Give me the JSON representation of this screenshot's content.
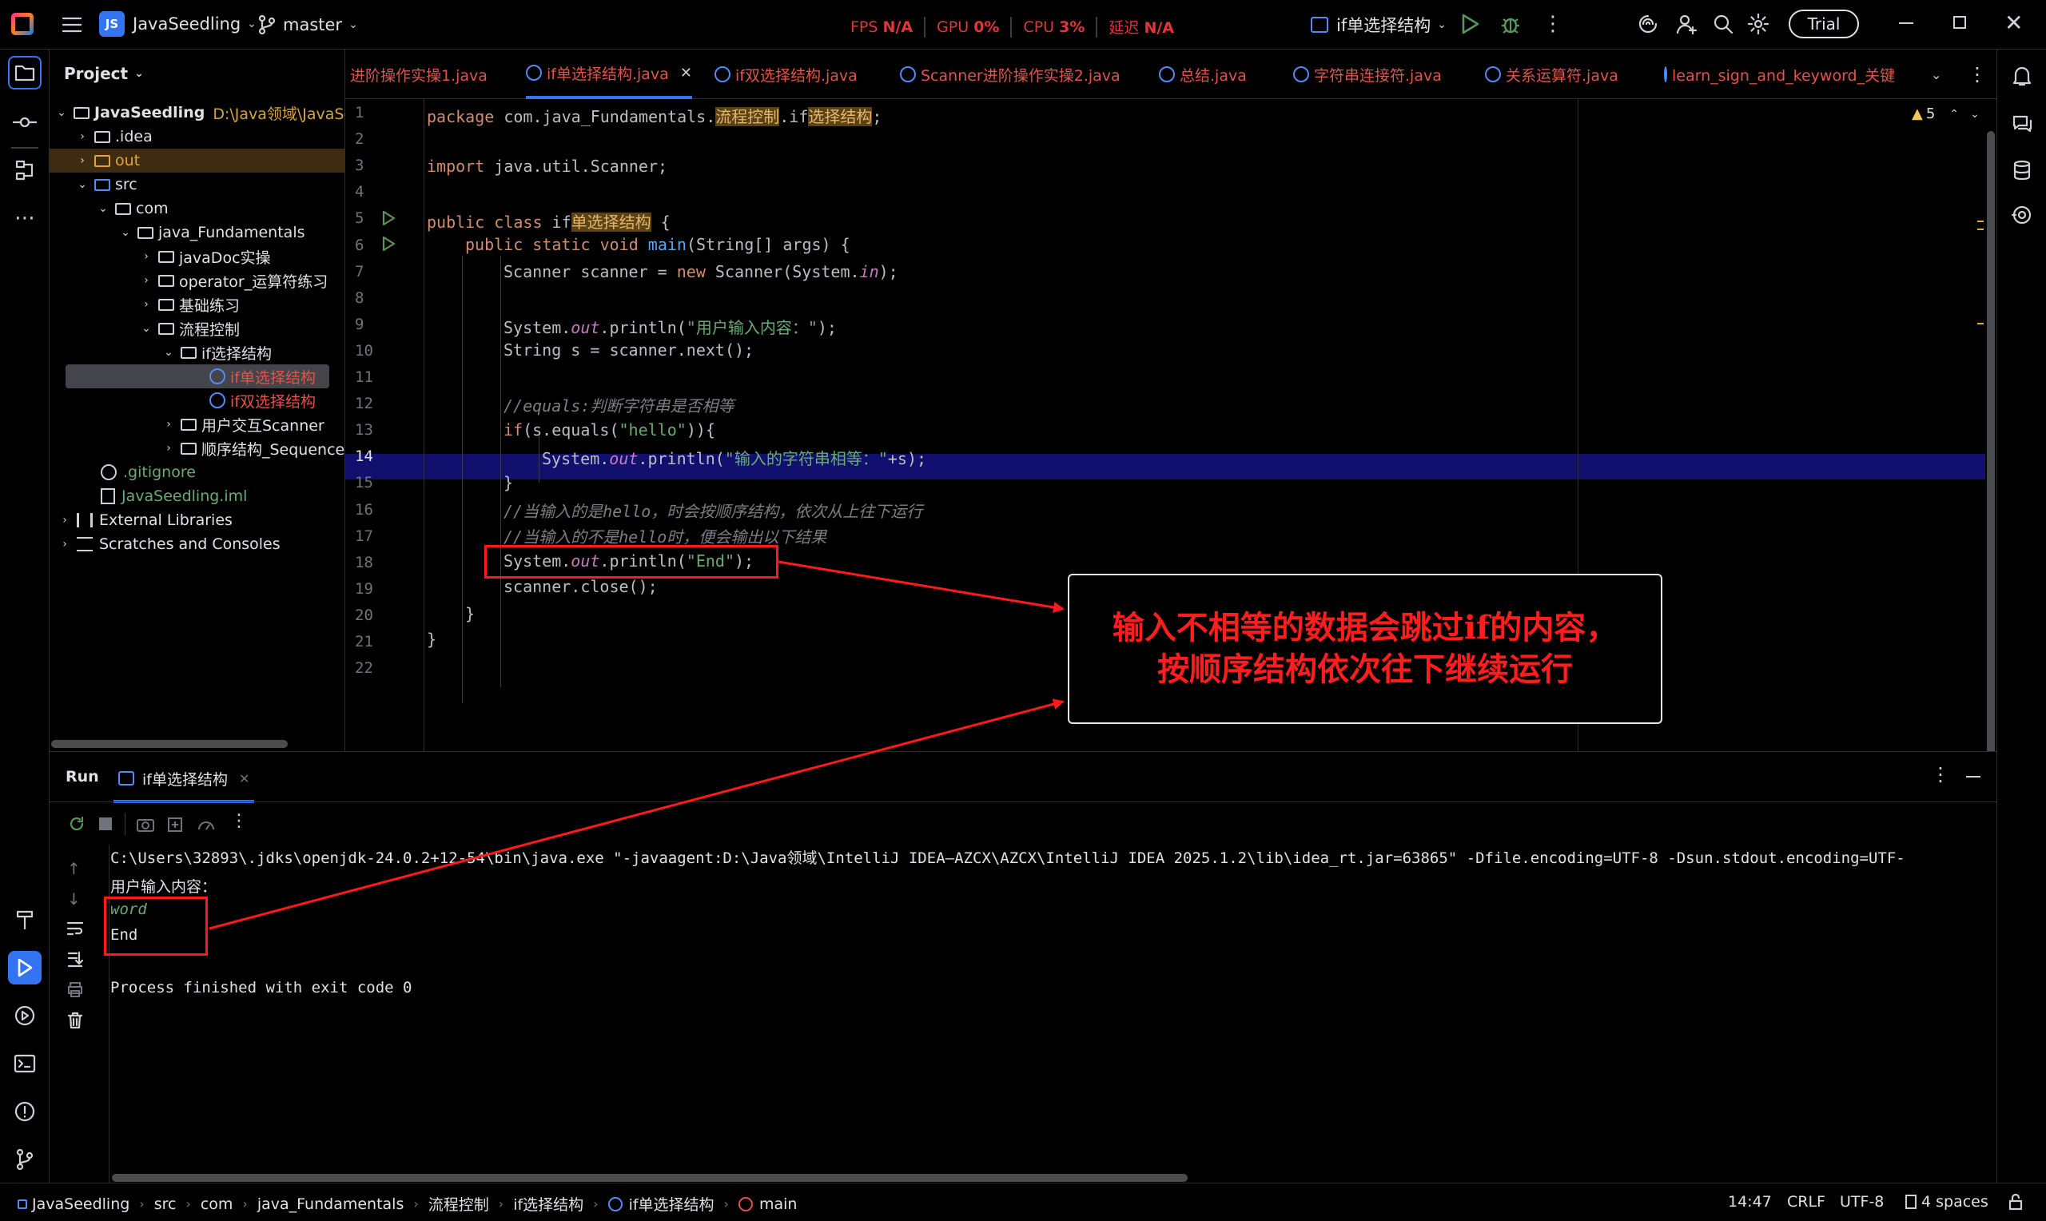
{
  "titlebar": {
    "project_badge": "JS",
    "project_name": "JavaSeedling",
    "branch": "master",
    "metrics": [
      {
        "label": "FPS",
        "value": "N/A"
      },
      {
        "label": "GPU",
        "value": "0%"
      },
      {
        "label": "CPU",
        "value": "3%"
      },
      {
        "label": "延迟",
        "value": "N/A"
      }
    ],
    "run_config": "if单选择结构",
    "trial": "Trial"
  },
  "project": {
    "title": "Project",
    "root_name": "JavaSeedling",
    "root_path": "D:\\Java领域\\JavaSeec",
    "items": [
      {
        "label": ".idea"
      },
      {
        "label": "out"
      },
      {
        "label": "src"
      },
      {
        "label": "com"
      },
      {
        "label": "java_Fundamentals"
      },
      {
        "label": "javaDoc实操"
      },
      {
        "label": "operator_运算符练习"
      },
      {
        "label": "基础练习"
      },
      {
        "label": "流程控制"
      },
      {
        "label": "if选择结构"
      },
      {
        "label": "if单选择结构"
      },
      {
        "label": "if双选择结构"
      },
      {
        "label": "用户交互Scanner"
      },
      {
        "label": "顺序结构_Sequence"
      },
      {
        "label": ".gitignore"
      },
      {
        "label": "JavaSeedling.iml"
      },
      {
        "label": "External Libraries"
      },
      {
        "label": "Scratches and Consoles"
      }
    ]
  },
  "tabs": [
    {
      "label": "进阶操作实操1.java"
    },
    {
      "label": "if单选择结构.java"
    },
    {
      "label": "if双选择结构.java"
    },
    {
      "label": "Scanner进阶操作实操2.java"
    },
    {
      "label": "总结.java"
    },
    {
      "label": "字符串连接符.java"
    },
    {
      "label": "关系运算符.java"
    },
    {
      "label": "learn_sign_and_keyword_关键字"
    }
  ],
  "editor": {
    "warning_count": "5",
    "line_numbers": [
      "1",
      "2",
      "3",
      "4",
      "5",
      "6",
      "7",
      "8",
      "9",
      "10",
      "11",
      "12",
      "13",
      "14",
      "15",
      "16",
      "17",
      "18",
      "19",
      "20",
      "21",
      "22"
    ],
    "code": {
      "l1_a": "package ",
      "l1_b": "com.java_Fundamentals.",
      "l1_c": "流程控制",
      "l1_d": ".if",
      "l1_e": "选择结构",
      "l1_f": ";",
      "l3_a": "import ",
      "l3_b": "java.util.Scanner;",
      "l5_a": "public class ",
      "l5_b": "if",
      "l5_c": "单选择结构",
      "l5_d": " {",
      "l6_a": "public static void ",
      "l6_b": "main",
      "l6_c": "(String[] args) {",
      "l7_a": "Scanner scanner = ",
      "l7_b": "new ",
      "l7_c": "Scanner(System.",
      "l7_d": "in",
      "l7_e": ");",
      "l9_a": "System.",
      "l9_b": "out",
      "l9_c": ".println(",
      "l9_d": "\"用户输入内容：\"",
      "l9_e": ");",
      "l10": "String s = scanner.next();",
      "l12": "//equals:判断字符串是否相等",
      "l13_a": "if",
      "l13_b": "(s.equals(",
      "l13_c": "\"hello\"",
      "l13_d": ")){",
      "l14_a": "System.",
      "l14_b": "out",
      "l14_c": ".println(",
      "l14_d": "\"输入的字符串相等：\"",
      "l14_e": "+s);",
      "l15": "}",
      "l16": "//当输入的是hello，时会按顺序结构，依次从上往下运行",
      "l17": "//当输入的不是hello时，便会输出以下结果",
      "l18_a": "System.",
      "l18_b": "out",
      "l18_c": ".println(",
      "l18_d": "\"End\"",
      "l18_e": ");",
      "l19": "scanner.close();",
      "l20": "}",
      "l21": "}"
    }
  },
  "callout": {
    "line1": "输入不相等的数据会跳过if的内容，",
    "line2": "按顺序结构依次往下继续运行"
  },
  "run": {
    "title": "Run",
    "tab": "if单选择结构",
    "console": {
      "cmd": "C:\\Users\\32893\\.jdks\\openjdk-24.0.2+12-54\\bin\\java.exe \"-javaagent:D:\\Java领域\\IntelliJ IDEA—AZCX\\AZCX\\IntelliJ IDEA 2025.1.2\\lib\\idea_rt.jar=63865\" -Dfile.encoding=UTF-8 -Dsun.stdout.encoding=UTF-",
      "prompt": "用户输入内容：",
      "input": "word",
      "output": "End",
      "exit": "Process finished with exit code 0"
    }
  },
  "statusbar": {
    "crumbs": [
      "JavaSeedling",
      "src",
      "com",
      "java_Fundamentals",
      "流程控制",
      "if选择结构",
      "if单选择结构",
      "main"
    ],
    "position": "14:47",
    "line_sep": "CRLF",
    "encoding": "UTF-8",
    "indent": "4 spaces"
  }
}
